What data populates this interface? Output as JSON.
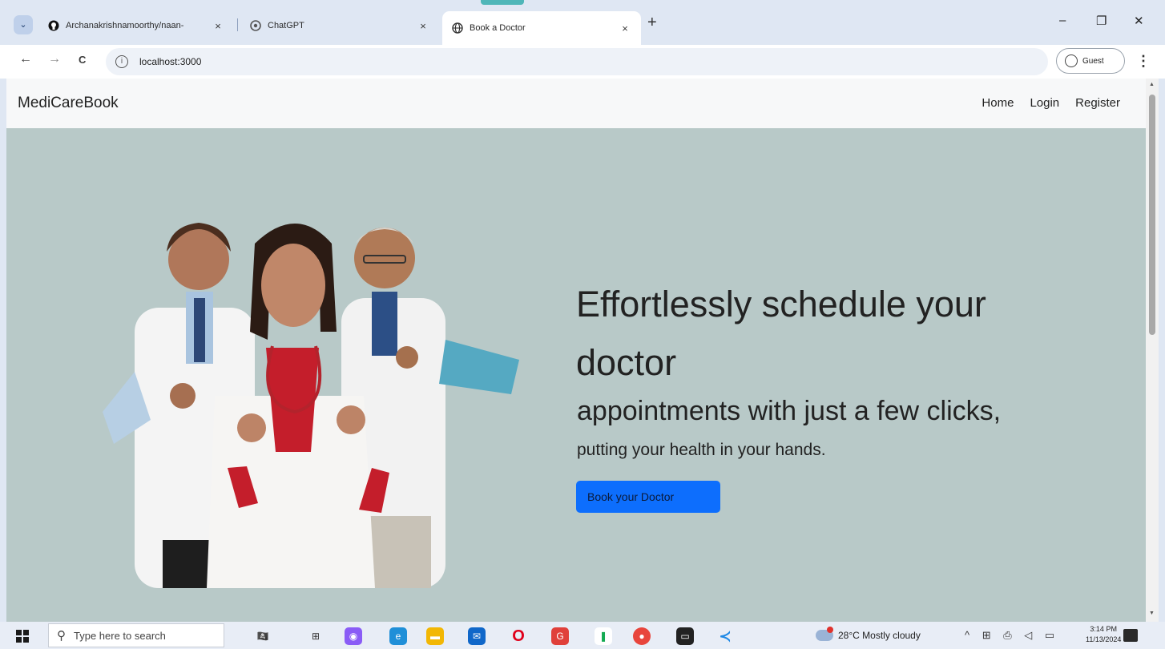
{
  "browser": {
    "tabs": [
      {
        "title": "Archanakrishnamoorthy/naan-",
        "close": "×",
        "favicon": "github-icon"
      },
      {
        "title": "ChatGPT",
        "close": "×",
        "favicon": "chatgpt-icon"
      },
      {
        "title": "Book a Doctor",
        "close": "×",
        "favicon": "globe-icon",
        "active": true
      }
    ],
    "new_tab": "+",
    "window_controls": {
      "minimize": "–",
      "restore": "❐",
      "close": "✕"
    },
    "nav": {
      "back": "←",
      "forward": "→",
      "reload": "C"
    },
    "address": "localhost:3000",
    "profile": "Guest",
    "menu": "⋮"
  },
  "navbar": {
    "brand": "MediCareBook",
    "links": [
      "Home",
      "Login",
      "Register"
    ]
  },
  "hero": {
    "headline": "Effortlessly schedule your doctor",
    "subheadline": "appointments with just a few clicks,",
    "tagline": "putting your health in your hands.",
    "cta": "Book your Doctor",
    "background": "#b8c9c8",
    "cta_color": "#0d6efd"
  },
  "taskbar": {
    "search_placeholder": "Type here to search",
    "weather": "28°C  Mostly cloudy",
    "tray": "^ ⊞ ⎙ ◁ ▭",
    "time": "3:14 PM",
    "date": "11/13/2024"
  }
}
